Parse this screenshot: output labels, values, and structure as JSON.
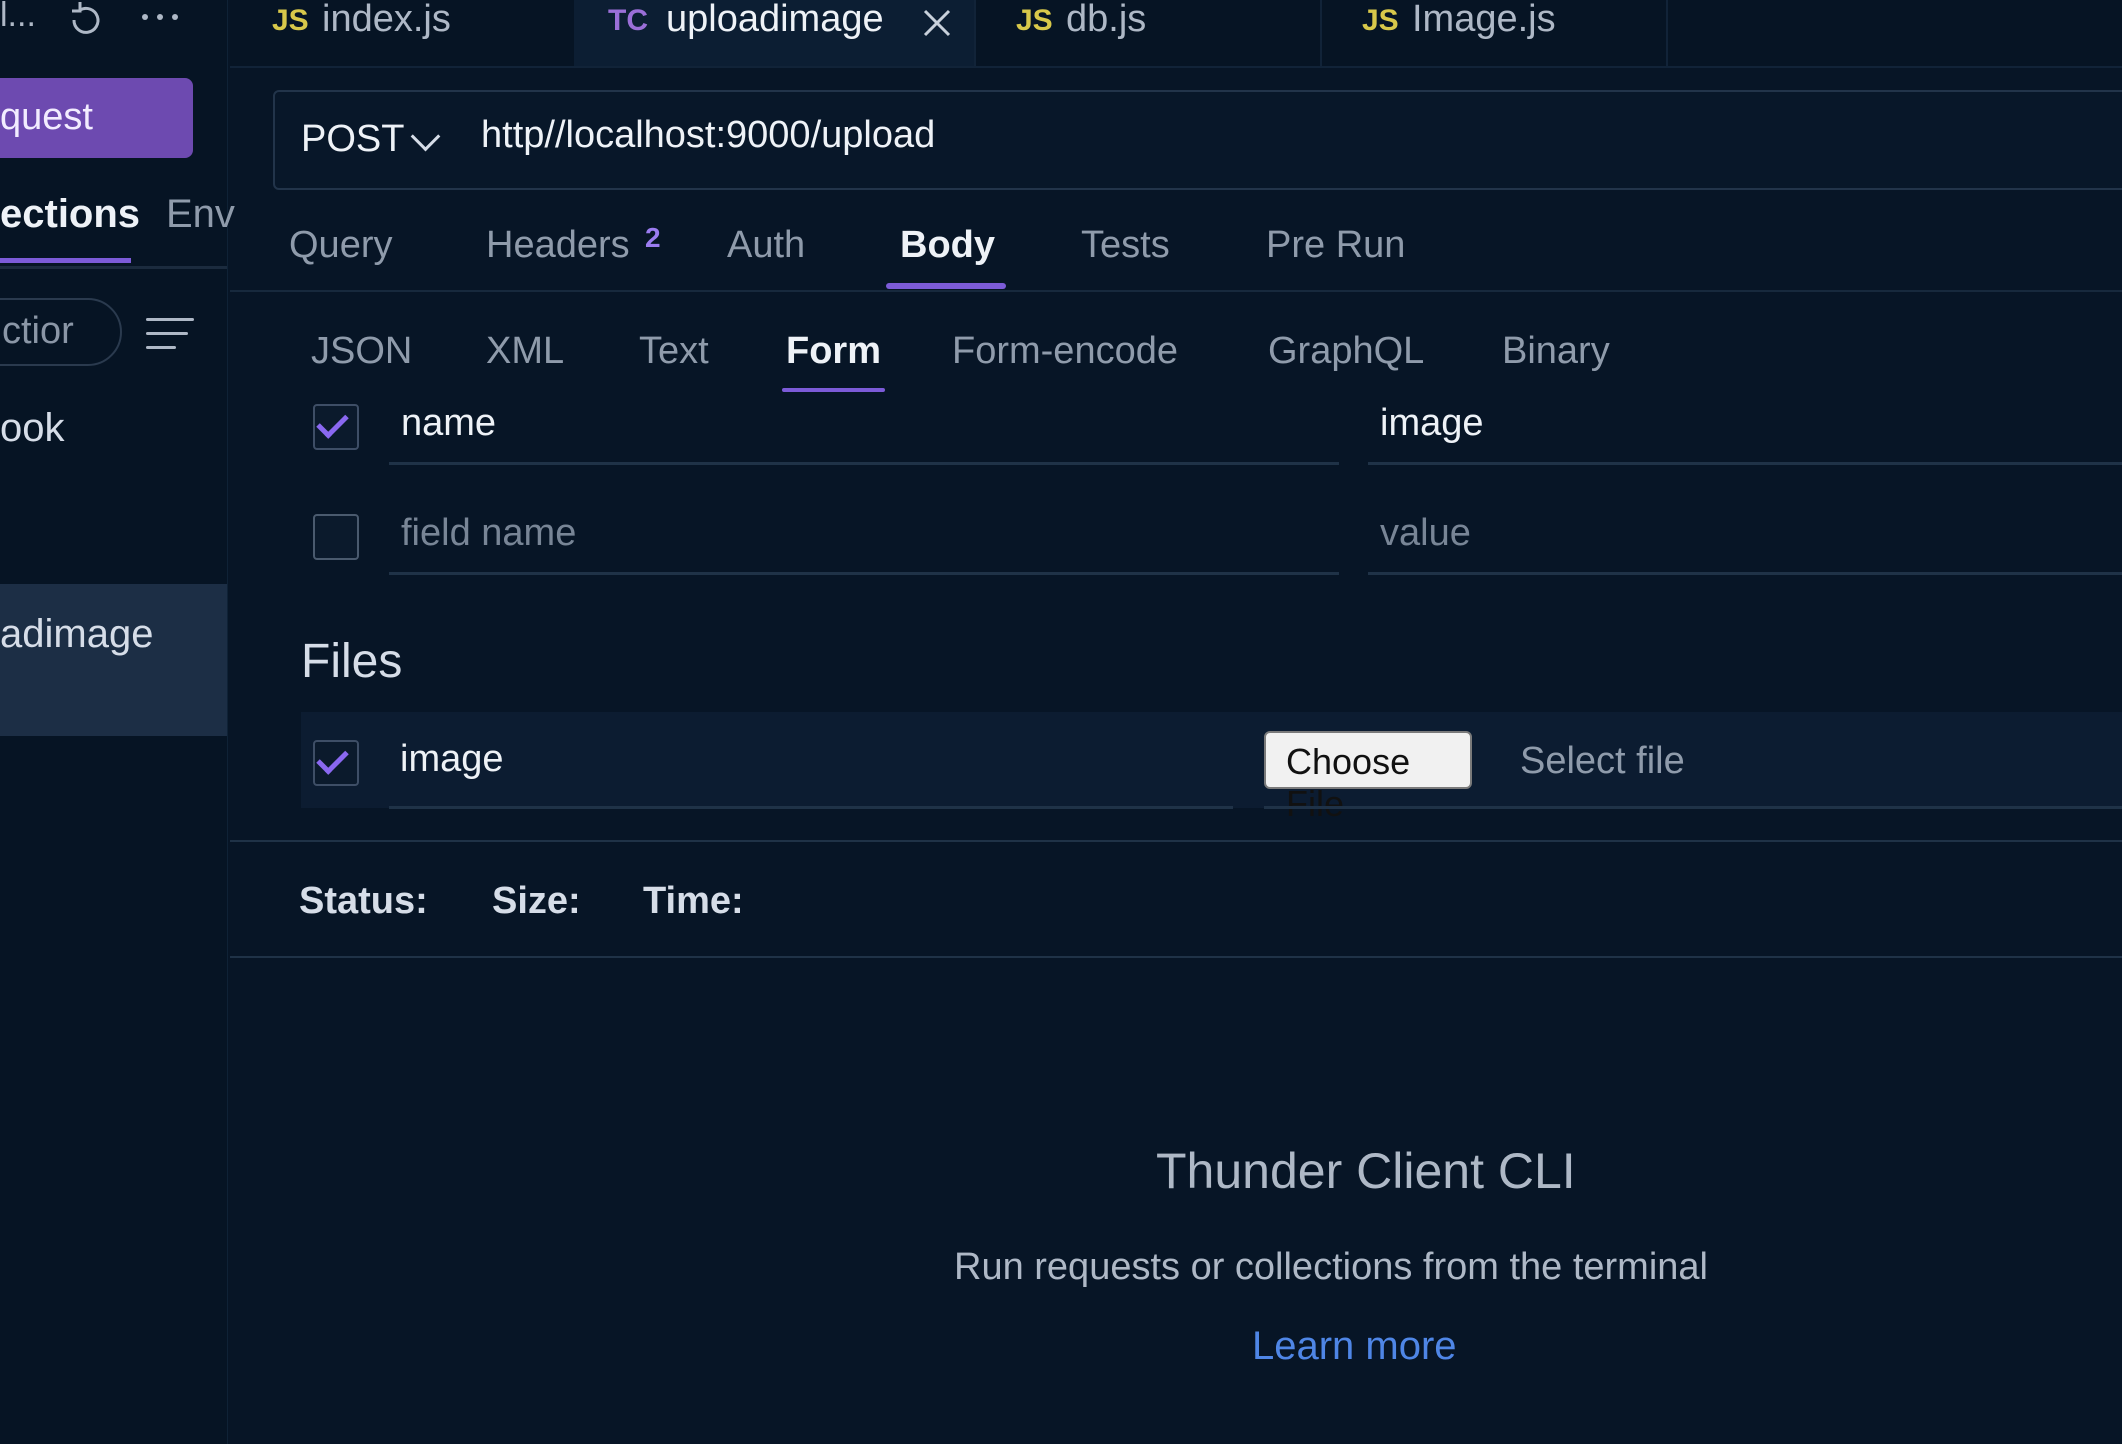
{
  "colors": {
    "accent": "#7c5bd8",
    "background": "#071526",
    "link": "#4f86e6",
    "js_badge": "#d8c84a",
    "tc_badge": "#9b6fd8"
  },
  "sidebar": {
    "top_truncated": "l...",
    "refresh_icon": "refresh-icon",
    "more_icon": "more-icon",
    "new_request_label": "quest",
    "tabs": [
      "ections",
      "Env"
    ],
    "filter_placeholder": "ctior",
    "sort_icon": "sort-icon",
    "items": [
      "ook",
      "adimage"
    ]
  },
  "file_tabs": [
    {
      "lang": "JS",
      "name": "index.js"
    },
    {
      "lang": "TC",
      "name": "uploadimage",
      "active": true,
      "close_icon": "close-icon"
    },
    {
      "lang": "JS",
      "name": "db.js"
    },
    {
      "lang": "JS",
      "name": "Image.js"
    }
  ],
  "request": {
    "method": "POST",
    "method_icon": "chevron-down-icon",
    "url": "http//localhost:9000/upload"
  },
  "request_tabs": [
    "Query",
    "Headers",
    "Auth",
    "Body",
    "Tests",
    "Pre Run"
  ],
  "headers_count": "2",
  "active_request_tab": "Body",
  "body_tabs": [
    "JSON",
    "XML",
    "Text",
    "Form",
    "Form-encode",
    "GraphQL",
    "Binary"
  ],
  "active_body_tab": "Form",
  "form_fields": [
    {
      "checked": true,
      "name": "name",
      "value": "image"
    },
    {
      "checked": false,
      "name_placeholder": "field name",
      "value_placeholder": "value"
    }
  ],
  "files": {
    "title": "Files",
    "rows": [
      {
        "checked": true,
        "name": "image",
        "choose_label": "Choose File",
        "select_label": "Select file"
      }
    ]
  },
  "response": {
    "status_label": "Status:",
    "size_label": "Size:",
    "time_label": "Time:"
  },
  "cli": {
    "title": "Thunder Client CLI",
    "subtitle": "Run requests or collections from the terminal",
    "link": "Learn more"
  }
}
